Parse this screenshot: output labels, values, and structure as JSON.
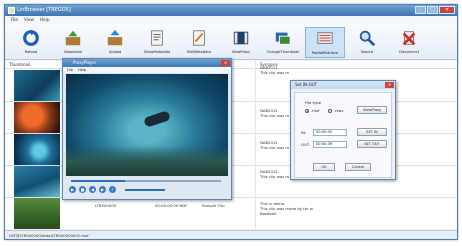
{
  "window": {
    "title": "LinBrowser [TREGOS]",
    "controls": [
      "–",
      "□",
      "✕"
    ]
  },
  "menu": [
    "File",
    "View",
    "Help"
  ],
  "toolbar": [
    {
      "label": "Reload",
      "icon": "reload-icon"
    },
    {
      "label": "Download",
      "icon": "download-icon"
    },
    {
      "label": "Upload",
      "icon": "upload-icon"
    },
    {
      "label": "ShowMetadata",
      "icon": "show-metadata-icon"
    },
    {
      "label": "EditMetadata",
      "icon": "edit-metadata-icon"
    },
    {
      "label": "ViewProxy",
      "icon": "view-proxy-icon"
    },
    {
      "label": "ChangeThumbnail",
      "icon": "change-thumbnail-icon"
    },
    {
      "label": "PartialRetrieve",
      "icon": "partial-retrieve-icon",
      "active": true
    },
    {
      "label": "Search",
      "icon": "search-icon"
    },
    {
      "label": "Disconnect",
      "icon": "disconnect-icon"
    }
  ],
  "columns": {
    "thumbnail": "Thumbnail",
    "synopsis": "Synopsis"
  },
  "rows": [
    {
      "synopsis": [
        "NAB2012",
        "This clip was m"
      ]
    },
    {
      "synopsis": [
        "NAB2012",
        "This clip was m"
      ]
    },
    {
      "synopsis": [
        "NAB2012",
        "This clip was m"
      ]
    },
    {
      "synopsis": [
        "NAB2012",
        "This clip was m"
      ]
    },
    {
      "id": "LTR000000",
      "timecode": "00:00:00:00 NDF",
      "title": "Sample Clip",
      "synopsis": [
        "This is demo.",
        "This clip was made by for w.",
        "Baseball."
      ]
    }
  ],
  "status": "LBF@LTR000000/data/LTR000000001.mxf",
  "player": {
    "title": "ProxyPlayer",
    "menu": [
      "File",
      "Help"
    ],
    "seek_fraction": 0.36
  },
  "dialog": {
    "title": "Set IN-OUT",
    "filetype_label": "File type",
    "radio_mxf": ".mxf",
    "radio_mov": ".mov",
    "viewproxy_button": "ViewProxy",
    "in_label": "IN:",
    "in_value": "00:00:35",
    "set_in_button": "SET IN",
    "out_label": "OUT:",
    "out_value": "00:00:39",
    "set_out_button": "SET OUT",
    "ok_button": "OK",
    "cancel_button": "Cancel"
  },
  "colors": {
    "accent": "#3f77b3",
    "selected": "#cde2f6",
    "close": "#c8463c"
  }
}
